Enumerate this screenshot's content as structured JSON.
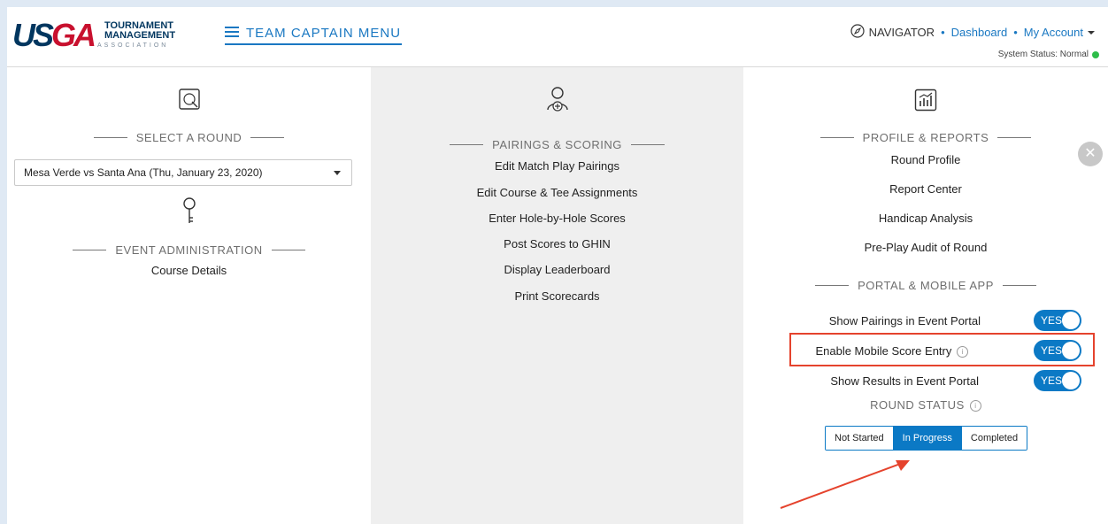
{
  "header": {
    "logo": {
      "brand": "USGA",
      "line1": "TOURNAMENT",
      "line2": "MANAGEMENT",
      "line3": "ASSOCIATION"
    },
    "menu_label": "TEAM CAPTAIN MENU",
    "navigator_label": "NAVIGATOR",
    "nav_links": [
      "Dashboard",
      "My Account"
    ],
    "system_status": "System Status: Normal",
    "status_color": "#2ebd4a"
  },
  "left": {
    "round_title": "SELECT A ROUND",
    "round_selected": "Mesa Verde vs Santa Ana (Thu, January 23, 2020)",
    "admin_title": "EVENT ADMINISTRATION",
    "admin_items": [
      "Course Details"
    ]
  },
  "middle": {
    "title": "PAIRINGS & SCORING",
    "items": [
      "Edit Match Play Pairings",
      "Edit Course & Tee Assignments",
      "Enter Hole-by-Hole Scores",
      "Post Scores to GHIN",
      "Display Leaderboard",
      "Print Scorecards"
    ]
  },
  "right": {
    "profile_title": "PROFILE & REPORTS",
    "profile_items": [
      "Round Profile",
      "Report Center",
      "Handicap Analysis",
      "Pre-Play Audit of Round"
    ],
    "portal_title": "PORTAL & MOBILE APP",
    "toggles": [
      {
        "label": "Show Pairings in Event Portal",
        "value": "YES"
      },
      {
        "label": "Enable Mobile Score Entry",
        "value": "YES"
      },
      {
        "label": "Show Results in Event Portal",
        "value": "YES"
      }
    ],
    "round_status_title": "ROUND STATUS",
    "round_status_options": [
      "Not Started",
      "In Progress",
      "Completed"
    ],
    "round_status_selected": "In Progress"
  },
  "colors": {
    "accent": "#0b79c5",
    "highlight": "#e5432d",
    "brand_red": "#c8102e",
    "brand_navy": "#00365f"
  }
}
